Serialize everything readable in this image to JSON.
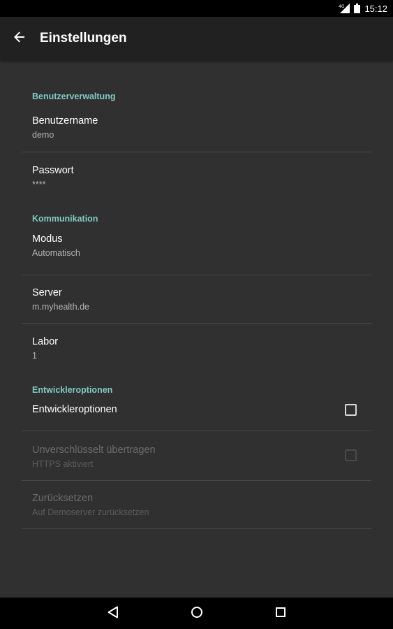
{
  "status_bar": {
    "time": "15:12",
    "signal_label": "4G"
  },
  "app_bar": {
    "title": "Einstellungen"
  },
  "categories": {
    "user": "Benutzerverwaltung",
    "comm": "Kommunikation",
    "dev": "Entwickleroptionen"
  },
  "prefs": {
    "username": {
      "title": "Benutzername",
      "summary": "demo"
    },
    "password": {
      "title": "Passwort",
      "summary": "****"
    },
    "mode": {
      "title": "Modus",
      "summary": "Automatisch"
    },
    "server": {
      "title": "Server",
      "summary": "m.myhealth.de"
    },
    "lab": {
      "title": "Labor",
      "summary": "1"
    },
    "dev_options": {
      "title": "Entwickleroptionen",
      "checked": false
    },
    "unencrypted": {
      "title": "Unverschlüsselt übertragen",
      "summary": "HTTPS aktiviert",
      "checked": false,
      "enabled": false
    },
    "reset": {
      "title": "Zurücksetzen",
      "summary": "Auf Demoserver zurücksetzen",
      "enabled": false
    }
  },
  "colors": {
    "accent": "#80cbc4",
    "background": "#303030",
    "app_bar": "#212121"
  }
}
